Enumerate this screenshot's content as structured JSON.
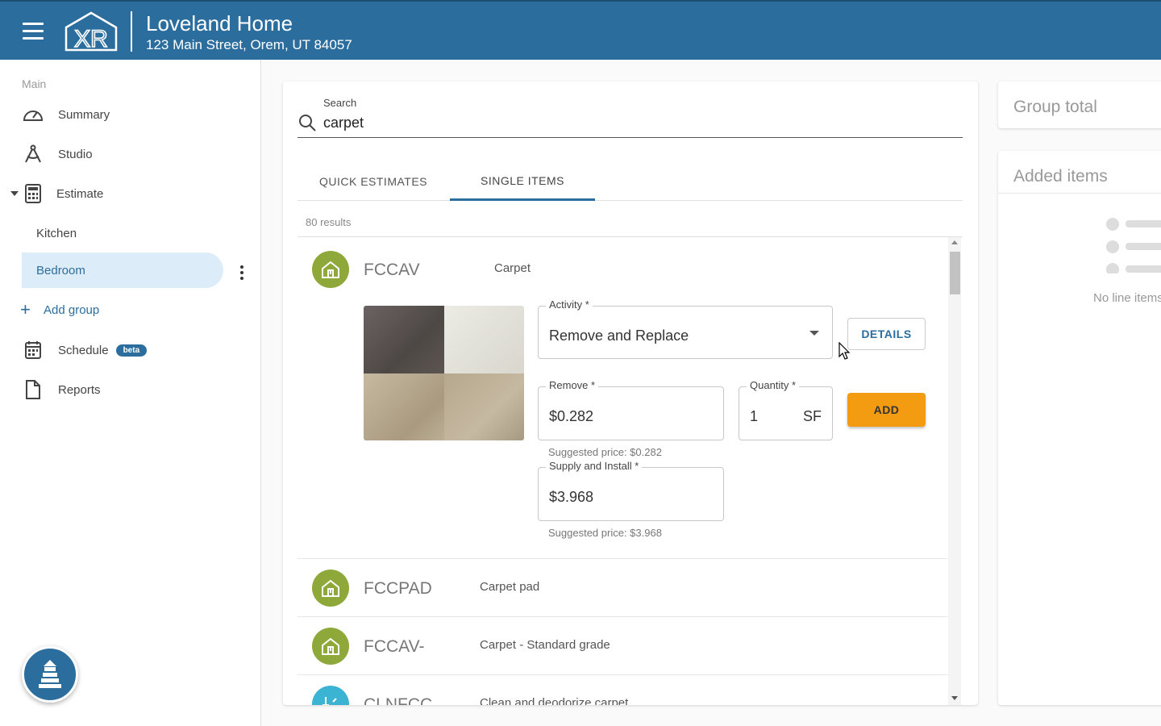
{
  "header": {
    "menu_icon": "hamburger-menu-icon",
    "logo_text": "XR",
    "project_title": "Loveland Home",
    "project_address": "123 Main Street, Orem, UT 84057"
  },
  "sidebar": {
    "section_label": "Main",
    "items": [
      {
        "label": "Summary",
        "icon": "speedometer-icon"
      },
      {
        "label": "Studio",
        "icon": "compass-drafting-icon"
      },
      {
        "label": "Estimate",
        "icon": "calculator-icon"
      }
    ],
    "groups": [
      {
        "label": "Kitchen"
      },
      {
        "label": "Bedroom"
      }
    ],
    "add_group_label": "Add group",
    "schedule": {
      "label": "Schedule",
      "badge": "beta",
      "icon": "calendar-icon"
    },
    "reports": {
      "label": "Reports",
      "icon": "document-icon"
    }
  },
  "search": {
    "label": "Search",
    "value": "carpet"
  },
  "tabs": [
    {
      "label": "QUICK ESTIMATES",
      "active": false
    },
    {
      "label": "SINGLE ITEMS",
      "active": true
    }
  ],
  "results_count": "80 results",
  "expanded_item": {
    "code": "FCCAV",
    "description": "Carpet",
    "activity": {
      "label": "Activity *",
      "value": "Remove and Replace"
    },
    "details_label": "DETAILS",
    "remove": {
      "label": "Remove *",
      "value": "$0.282",
      "helper": "Suggested price: $0.282"
    },
    "quantity": {
      "label": "Quantity *",
      "value": "1",
      "unit": "SF"
    },
    "add_label": "ADD",
    "supply_install": {
      "label": "Supply and Install *",
      "value": "$3.968",
      "helper": "Suggested price: $3.968"
    }
  },
  "items": [
    {
      "code": "FCCPAD",
      "description": "Carpet pad"
    },
    {
      "code": "FCCAV-",
      "description": "Carpet - Standard grade"
    },
    {
      "code": "CLNFCC",
      "description": "Clean and deodorize carpet"
    }
  ],
  "right_panel": {
    "group_total_label": "Group total",
    "added_items_label": "Added items",
    "empty_text": "No line items"
  },
  "colors": {
    "brand": "#2b6e9e",
    "accent": "#f39c12",
    "category_green": "#8fa83a",
    "category_teal": "#3bb3d3",
    "active_bg": "#dcecf8"
  }
}
